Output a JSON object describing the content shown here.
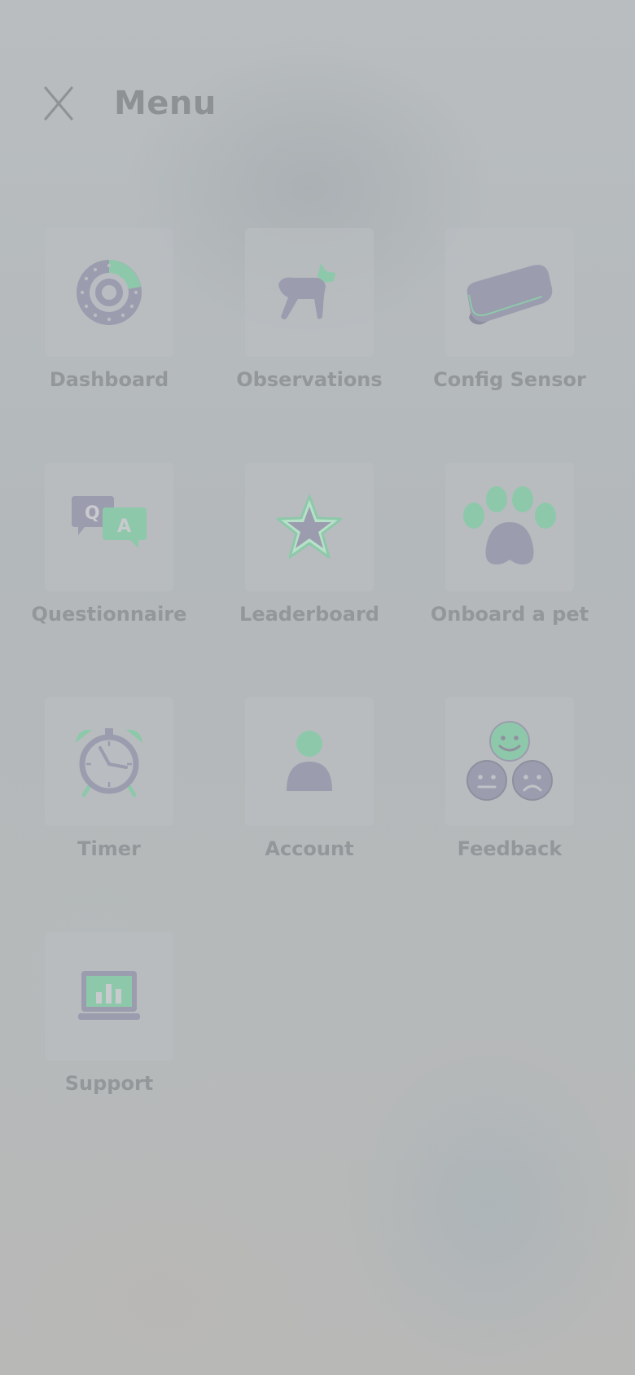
{
  "header": {
    "title": "Menu",
    "close_icon": "close-icon"
  },
  "colors": {
    "icon_slate": "#9b9cae",
    "icon_green": "#8ec8aa",
    "label": "#939799",
    "title": "#8d9194"
  },
  "menu": {
    "items": [
      {
        "label": "Dashboard",
        "icon": "dashboard-gauge-icon"
      },
      {
        "label": "Observations",
        "icon": "dog-icon"
      },
      {
        "label": "Config Sensor",
        "icon": "sensor-device-icon"
      },
      {
        "label": "Questionnaire",
        "icon": "qa-chat-icon"
      },
      {
        "label": "Leaderboard",
        "icon": "star-icon"
      },
      {
        "label": "Onboard a pet",
        "icon": "paw-icon"
      },
      {
        "label": "Timer",
        "icon": "alarm-clock-icon"
      },
      {
        "label": "Account",
        "icon": "person-icon"
      },
      {
        "label": "Feedback",
        "icon": "faces-icon"
      },
      {
        "label": "Support",
        "icon": "laptop-chart-icon"
      }
    ]
  }
}
